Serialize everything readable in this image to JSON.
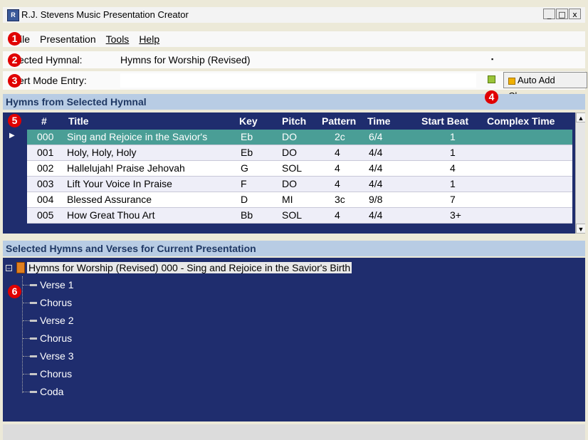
{
  "window": {
    "title": "R.J. Stevens Music Presentation Creator",
    "app_icon": "app-icon",
    "controls": [
      "_",
      "□",
      "x"
    ]
  },
  "menu": {
    "items": [
      {
        "label": "File",
        "shown": "ile"
      },
      {
        "label": "Presentation"
      },
      {
        "label": "Tools"
      },
      {
        "label": "Help"
      }
    ]
  },
  "badges": [
    "1",
    "2",
    "3",
    "4",
    "5",
    "6"
  ],
  "hymnal_row": {
    "label": "ected Hymnal:",
    "value": "Hymns for Worship (Revised)",
    "dropdown_icon": "dropdown-arrow-icon"
  },
  "insert_row": {
    "label": "ert Mode Entry:",
    "value": "",
    "button_label": "Auto Add Chorus"
  },
  "hymns_section": {
    "title": "Hymns from Selected Hymnal",
    "columns": [
      "#",
      "Title",
      "Key",
      "Pitch",
      "Pattern",
      "Time",
      "Start Beat",
      "Complex Time"
    ],
    "rows": [
      {
        "num": "000",
        "title": "Sing and Rejoice in the Savior's",
        "key": "Eb",
        "pitch": "DO",
        "pattern": "2c",
        "time": "6/4",
        "start": "1",
        "complex": ""
      },
      {
        "num": "001",
        "title": "Holy, Holy, Holy",
        "key": "Eb",
        "pitch": "DO",
        "pattern": "4",
        "time": "4/4",
        "start": "1",
        "complex": ""
      },
      {
        "num": "002",
        "title": "Hallelujah! Praise Jehovah",
        "key": "G",
        "pitch": "SOL",
        "pattern": "4",
        "time": "4/4",
        "start": "4",
        "complex": ""
      },
      {
        "num": "003",
        "title": "Lift Your Voice In Praise",
        "key": "F",
        "pitch": "DO",
        "pattern": "4",
        "time": "4/4",
        "start": "1",
        "complex": ""
      },
      {
        "num": "004",
        "title": "Blessed Assurance",
        "key": "D",
        "pitch": "MI",
        "pattern": "3c",
        "time": "9/8",
        "start": "7",
        "complex": ""
      },
      {
        "num": "005",
        "title": "How Great Thou Art",
        "key": "Bb",
        "pitch": "SOL",
        "pattern": "4",
        "time": "4/4",
        "start": "3+",
        "complex": ""
      }
    ],
    "selected_index": 0
  },
  "presentation_section": {
    "title": "Selected Hymns and Verses for Current Presentation",
    "root_label": "Hymns for Worship (Revised)  000 - Sing and Rejoice in the Savior's Birth",
    "children": [
      "Verse 1",
      "Chorus",
      "Verse 2",
      "Chorus",
      "Verse 3",
      "Chorus",
      "Coda"
    ]
  }
}
